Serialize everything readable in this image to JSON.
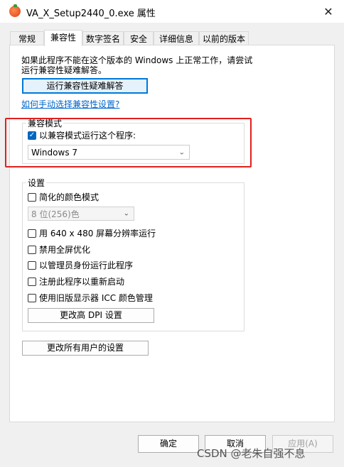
{
  "window": {
    "title": "VA_X_Setup2440_0.exe 属性",
    "close_label": "✕"
  },
  "tabs": [
    {
      "label": "常规"
    },
    {
      "label": "兼容性"
    },
    {
      "label": "数字签名"
    },
    {
      "label": "安全"
    },
    {
      "label": "详细信息"
    },
    {
      "label": "以前的版本"
    }
  ],
  "intro": {
    "line1": "如果此程序不能在这个版本的 Windows 上正常工作，请尝试",
    "line2": "运行兼容性疑难解答。"
  },
  "troubleshoot_button": "运行兼容性疑难解答",
  "manual_link": "如何手动选择兼容性设置?",
  "compat_mode": {
    "group_label": "兼容模式",
    "checkbox_label": "以兼容模式运行这个程序:",
    "checked": true,
    "selected_os": "Windows 7"
  },
  "settings": {
    "group_label": "设置",
    "reduced_color": "简化的颜色模式",
    "color_select": "8 位(256)色",
    "res_640": "用 640 x 480 屏幕分辨率运行",
    "disable_fullscreen": "禁用全屏优化",
    "run_admin": "以管理员身份运行此程序",
    "register_restart": "注册此程序以重新启动",
    "legacy_icc": "使用旧版显示器 ICC 颜色管理",
    "dpi_button": "更改高 DPI 设置"
  },
  "all_users_button": "更改所有用户的设置",
  "footer": {
    "ok": "确定",
    "cancel": "取消",
    "apply": "应用(A)"
  },
  "watermark": "CSDN @老朱自强不息",
  "colors": {
    "highlight": "#e0201f",
    "link": "#0066cc",
    "accent": "#0067c0"
  }
}
